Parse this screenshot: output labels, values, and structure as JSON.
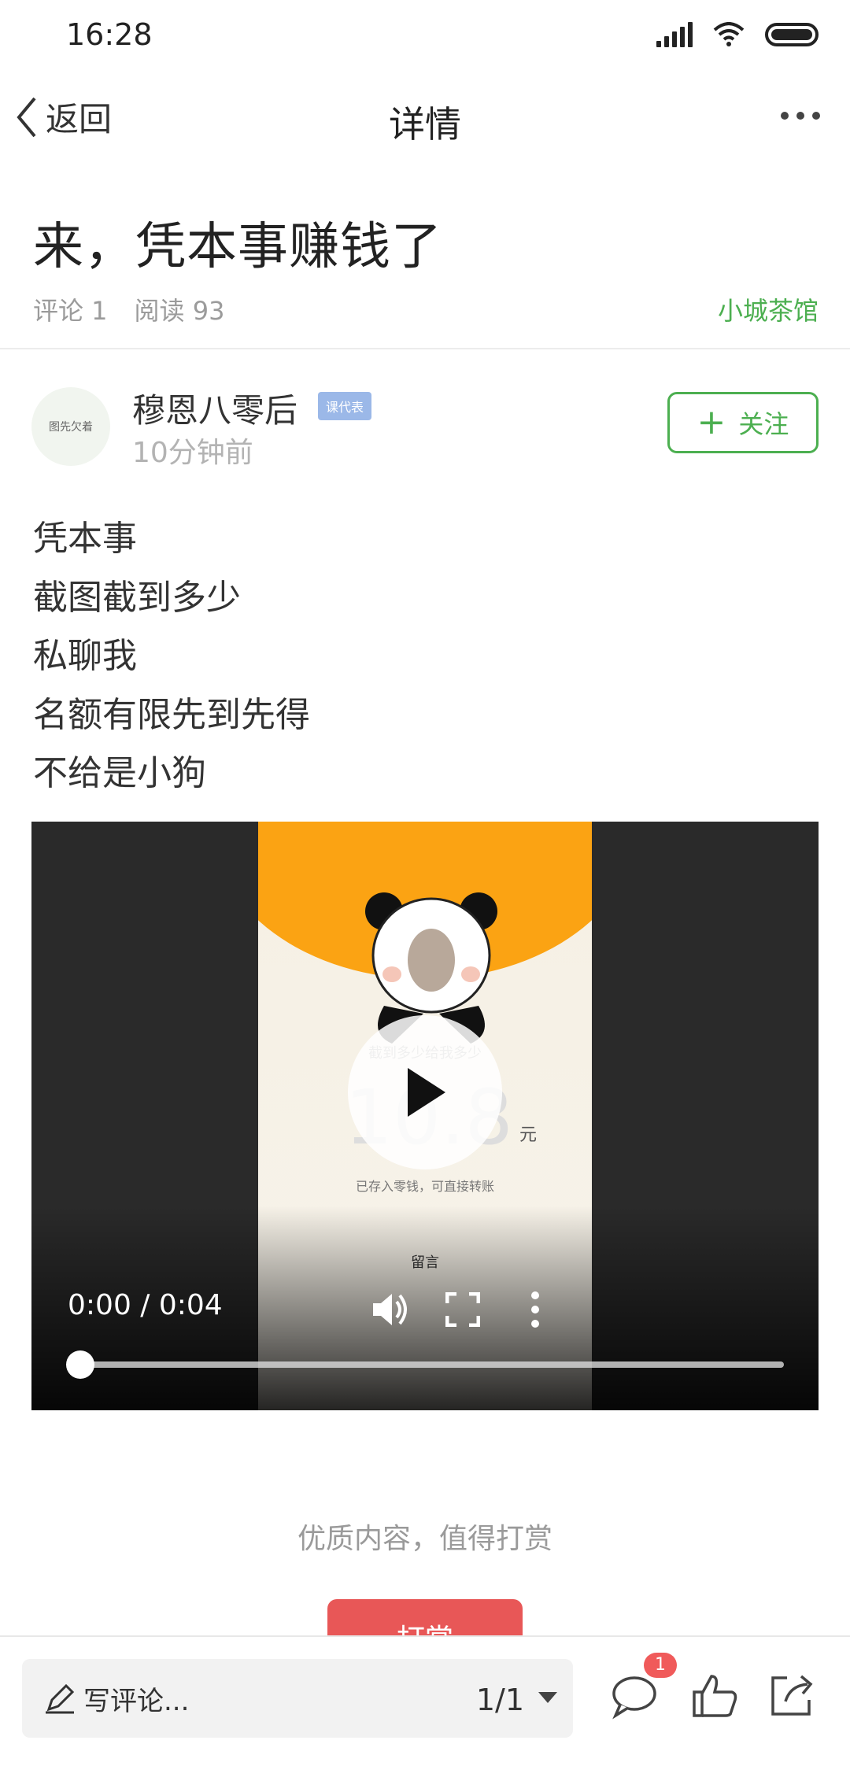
{
  "status_bar": {
    "time": "16:28"
  },
  "nav": {
    "back_label": "返回",
    "title": "详情"
  },
  "post": {
    "title": "来，凭本事赚钱了",
    "comments": "评论 1",
    "reads": "阅读 93",
    "channel": "小城茶馆"
  },
  "author": {
    "avatar_text": "图先欠着",
    "name": "穆恩八零后",
    "badge": "课代表",
    "time": "10分钟前",
    "follow_label": "关注"
  },
  "body_lines": [
    "凭本事",
    "截图截到多少",
    "私聊我",
    "名额有限先到先得",
    "不给是小狗"
  ],
  "video": {
    "frame_caption": "截到多少给我多少",
    "frame_amount": "10.8",
    "frame_unit": "元",
    "frame_sub": "已存入零钱，可直接转账",
    "frame_message": "留言",
    "time": "0:00 / 0:04",
    "progress": 0
  },
  "reward": {
    "prompt": "优质内容，值得打赏",
    "button_label": "打赏"
  },
  "bottom_bar": {
    "comment_placeholder": "写评论...",
    "page_indicator": "1/1",
    "comment_count_badge": "1"
  },
  "colors": {
    "accent_green": "#4caf50",
    "reward_red": "#e85757",
    "badge_red": "#f05a5a"
  }
}
